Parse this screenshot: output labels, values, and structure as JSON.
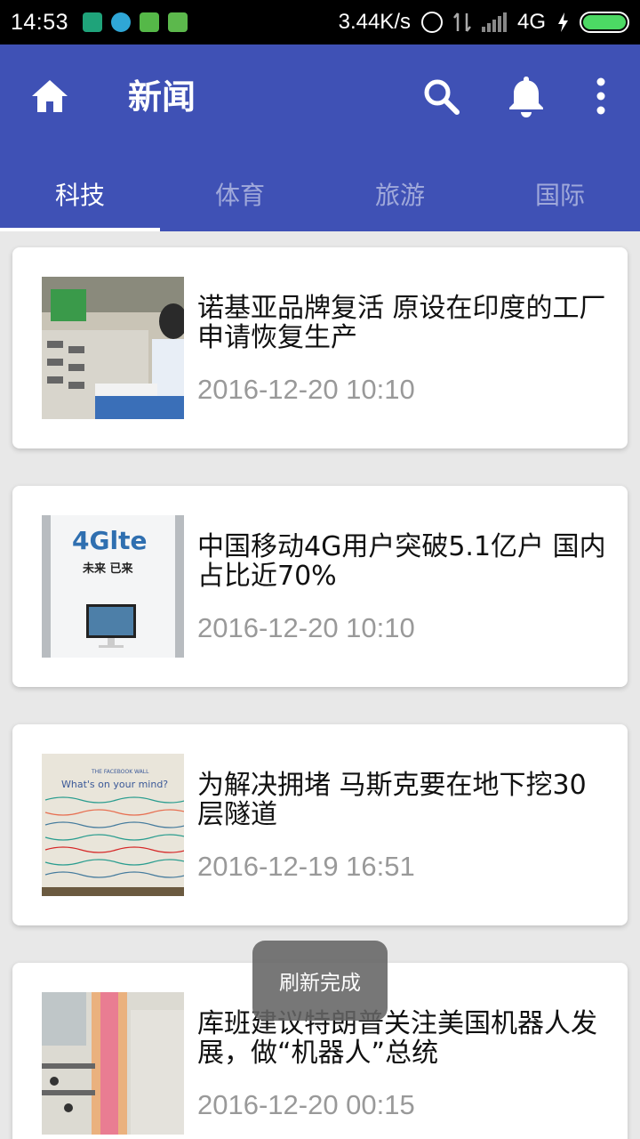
{
  "status_bar": {
    "time": "14:53",
    "net_speed": "3.44K/s",
    "network": "4G"
  },
  "app_bar": {
    "title": "新闻",
    "color": "#3f51b5"
  },
  "tabs": [
    {
      "label": "科技"
    },
    {
      "label": "体育"
    },
    {
      "label": "旅游"
    },
    {
      "label": "国际"
    }
  ],
  "news": [
    {
      "title": "诺基亚品牌复活 原设在印度的工厂申请恢复生产",
      "time": "2016-12-20 10:10",
      "image": "factory-photo"
    },
    {
      "title": "中国移动4G用户突破5.1亿户 国内占比近70%",
      "time": "2016-12-20 10:10",
      "image": "4g-lte-display-photo"
    },
    {
      "title": "为解决拥堵 马斯克要在地下挖30层隧道",
      "time": "2016-12-19 16:51",
      "image": "facebook-wall-photo"
    },
    {
      "title": "库班建议特朗普关注美国机器人发展，做“机器人”总统",
      "time": "2016-12-20 00:15",
      "image": "colorful-interior-photo"
    }
  ],
  "thumb_text": {
    "lte_logo": "4Glte",
    "lte_slogan": "未来 已来",
    "wall_header": "THE FACEBOOK WALL",
    "wall_question": "What's on your mind?"
  },
  "toast": {
    "message": "刷新完成"
  },
  "battery_level": 1.0
}
